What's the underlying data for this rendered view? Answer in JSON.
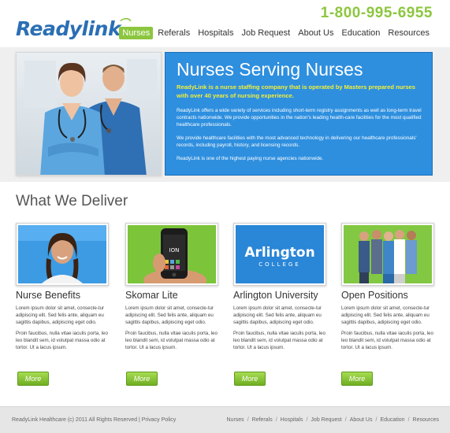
{
  "header": {
    "logo_text_1": "Ready",
    "logo_text_2": "link",
    "phone": "1-800-995-6955",
    "nav": [
      {
        "label": "Nurses",
        "active": true
      },
      {
        "label": "Referals",
        "active": false
      },
      {
        "label": "Hospitals",
        "active": false
      },
      {
        "label": "Job Request",
        "active": false
      },
      {
        "label": "About Us",
        "active": false
      },
      {
        "label": "Education",
        "active": false
      },
      {
        "label": "Resources",
        "active": false
      }
    ]
  },
  "hero": {
    "title": "Nurses Serving Nurses",
    "lead": "ReadyLink is a nurse staffing company that is operated by Masters prepared nurses with over 40 years of nursing experience.",
    "p1": "ReadyLink offers a wide variety of services including short-term registry assignments as well as long-term travel contracts nationwide. We provide opportunities in the nation's leading health-care facilities for the most qualified healthcare professionals.",
    "p2": "We provide healthcare facilities with the most advanced technology in delivering our healthcare professionals' records, including payroll, history, and licensing records.",
    "p3": "ReadyLink is one of the highest paying nurse agencies nationwide."
  },
  "section": {
    "title": "What We Deliver",
    "cards": [
      {
        "title": "Nurse Benefits",
        "p1": "Lorem ipsum dolor sit amet, consecte-tur adipiscing elit. Sed felis ante, aliquam eu sagittis dapibus, adipiscing eget odio.",
        "p2": "Proin faucibus, nulla vitae iaculis porta, leo leo blandit sem, id volutpat massa odio at tortor. Ut a lacus ipsum.",
        "button": "More"
      },
      {
        "title": "Skomar Lite",
        "phone_text": "ION",
        "p1": "Lorem ipsum dolor sit amet, consecte-tur adipiscing elit. Sed felis ante, aliquam eu sagittis dapibus, adipiscing eget odio.",
        "p2": "Proin faucibus, nulla vitae iaculis porta, leo leo blandit sem, id volutpat massa odio at tortor. Ut a lacus ipsum.",
        "button": "More"
      },
      {
        "title": "Arlington University",
        "logo_line1": "Arlington",
        "logo_line2": "COLLEGE",
        "p1": "Lorem ipsum dolor sit amet, consecte-tur adipiscing elit. Sed felis ante, aliquam eu sagittis dapibus, adipiscing eget odio.",
        "p2": "Proin faucibus, nulla vitae iaculis porta, leo leo blandit sem, id volutpat massa odio at tortor. Ut a lacus ipsum.",
        "button": "More"
      },
      {
        "title": "Open Positions",
        "p1": "Lorem ipsum dolor sit amet, consecte-tur adipiscing elit. Sed felis ante, aliquam eu sagittis dapibus, adipiscing eget odio.",
        "p2": "Proin faucibus, nulla vitae iaculis porta, leo leo blandit sem, id volutpat massa odio at tortor. Ut a lacus ipsum.",
        "button": "More"
      }
    ]
  },
  "footer": {
    "copyright": "ReadyLink Healthcare (c) 2011 All Rights Reserved",
    "privacy": "Privacy Policy",
    "nav": [
      "Nurses",
      "Referals",
      "Hospitals",
      "Job Request",
      "About Us",
      "Education",
      "Resources"
    ]
  },
  "colors": {
    "brand_blue": "#2a6fb4",
    "accent_green": "#8cc63f",
    "panel_blue": "#2e8fdf",
    "lead_yellow": "#f2ef3a"
  }
}
